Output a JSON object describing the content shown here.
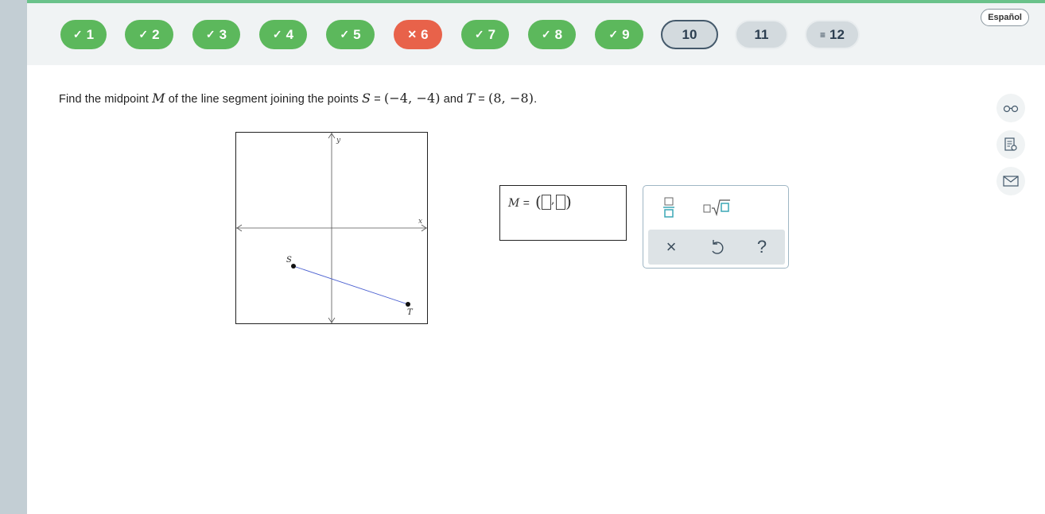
{
  "header": {
    "language_button": "Español",
    "questions": [
      {
        "label": "1",
        "state": "done",
        "mark": "✓"
      },
      {
        "label": "2",
        "state": "done",
        "mark": "✓"
      },
      {
        "label": "3",
        "state": "done",
        "mark": "✓"
      },
      {
        "label": "4",
        "state": "done",
        "mark": "✓"
      },
      {
        "label": "5",
        "state": "done",
        "mark": "✓"
      },
      {
        "label": "6",
        "state": "wrong",
        "mark": "✕"
      },
      {
        "label": "7",
        "state": "done",
        "mark": "✓"
      },
      {
        "label": "8",
        "state": "done",
        "mark": "✓"
      },
      {
        "label": "9",
        "state": "done",
        "mark": "✓"
      },
      {
        "label": "10",
        "state": "current",
        "mark": ""
      },
      {
        "label": "11",
        "state": "todo",
        "mark": ""
      },
      {
        "label": "12",
        "state": "todo",
        "mark": "≡"
      }
    ]
  },
  "question": {
    "text_1": "Find the midpoint",
    "var_M": "M",
    "text_2": "of the line segment joining the points",
    "var_S": "S",
    "eq": "=",
    "point_S": "(−4, −4)",
    "text_and": "and",
    "var_T": "T",
    "point_T": "(8, −8)",
    "period": "."
  },
  "graph": {
    "x_axis_label": "x",
    "y_axis_label": "y",
    "point_S_label": "S",
    "point_T_label": "T",
    "point_S": [
      -4,
      -4
    ],
    "point_T": [
      8,
      -8
    ],
    "range": [
      -10,
      10
    ],
    "segment_color": "#4a5fd0"
  },
  "answer": {
    "label": "M",
    "equals": "=",
    "open_paren": "(",
    "comma": ",",
    "close_paren": ")"
  },
  "palette": {
    "fraction_icon": "fraction-icon",
    "sqrt_icon": "sqrt-icon",
    "clear_label": "×",
    "undo_icon": "undo-icon",
    "help_label": "?",
    "accent_color": "#3aa7b5"
  },
  "side_tools": [
    "glasses-icon",
    "notes-icon",
    "mail-icon"
  ],
  "colors": {
    "done": "#5cb85c",
    "wrong": "#e8624a",
    "top_accent": "#6ac28a"
  }
}
